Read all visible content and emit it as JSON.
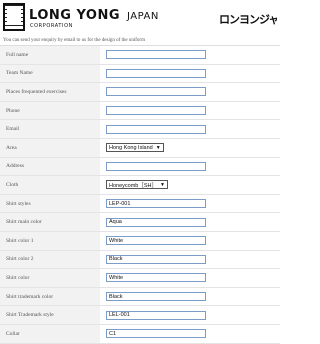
{
  "header": {
    "brand": "LONG YONG",
    "brand_suffix": "JAPAN",
    "corporation": "CORPORATION",
    "katakana": "ロンヨンジャパン"
  },
  "intro": "You can send your enquiry by email to us for the design of the uniform",
  "rows": [
    {
      "label": "Full name",
      "type": "input",
      "value": ""
    },
    {
      "label": "Team Name",
      "type": "input",
      "value": ""
    },
    {
      "label": "Places frequented exercises",
      "type": "input",
      "value": ""
    },
    {
      "label": "Phone",
      "type": "input",
      "value": ""
    },
    {
      "label": "Email",
      "type": "input",
      "value": ""
    },
    {
      "label": "Area",
      "type": "select",
      "value": "Hong Kong Island"
    },
    {
      "label": "Address",
      "type": "input",
      "value": ""
    },
    {
      "label": "Cloth",
      "type": "select",
      "value": "Honeycomb［SH］"
    },
    {
      "label": "Shirt styles",
      "type": "input",
      "value": "LEP-001"
    },
    {
      "label": "Shirt main color",
      "type": "input",
      "value": "Aqua"
    },
    {
      "label": "Shirt color 1",
      "type": "input",
      "value": "White"
    },
    {
      "label": "Shirt color 2",
      "type": "input",
      "value": "Black"
    },
    {
      "label": "Shirt color",
      "type": "input",
      "value": "White"
    },
    {
      "label": "Shirt trademark color",
      "type": "input",
      "value": "Black"
    },
    {
      "label": "Shirt Trademark style",
      "type": "input",
      "value": "LEL-001"
    },
    {
      "label": "Collar",
      "type": "input",
      "value": "C1"
    }
  ]
}
